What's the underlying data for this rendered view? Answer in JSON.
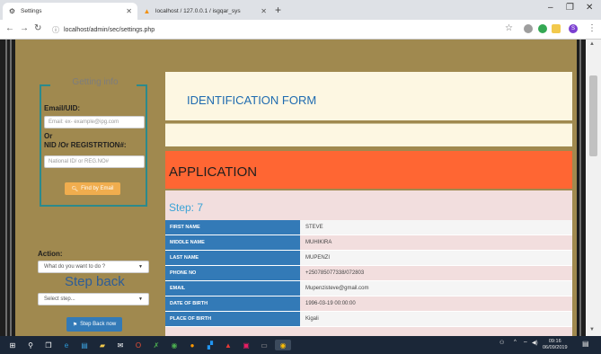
{
  "browser": {
    "tabs": [
      {
        "title": "Settings",
        "active": true
      },
      {
        "title": "localhost / 127.0.0.1 / isgqar_sys",
        "active": false
      }
    ],
    "url": "localhost/admin/sec/settings.php"
  },
  "sidebar": {
    "getting_info_title": "Getting info",
    "email_label": "Email/UID:",
    "email_placeholder": "Email: ex- example@ipg.com",
    "or_label": "Or",
    "nid_label": "NID /Or REGISTRTION#:",
    "nid_placeholder": "National ID/ or REG.NO#",
    "find_button": "Find by Email",
    "action_label": "Action:",
    "action_select_value": "What do you want to do ?",
    "stepback_title": "Step back",
    "step_select_value": "Select step...",
    "stepback_button": "Step Back now"
  },
  "main": {
    "form_title": "IDENTIFICATION FORM",
    "application_title": "APPLICATION",
    "step_label": "Step: 7",
    "rows": [
      {
        "key": "FIRST NAME",
        "value": "STEVE"
      },
      {
        "key": "MIDDLE NAME",
        "value": "MUHIKIRA"
      },
      {
        "key": "LAST NAME",
        "value": "MUPENZI"
      },
      {
        "key": "PHONE NO",
        "value": "+250785077338/072803"
      },
      {
        "key": "EMAIL",
        "value": "Mupenzisteve@gmail.com"
      },
      {
        "key": "DATE OF BIRTH",
        "value": "1996-03-19 00:00:00"
      },
      {
        "key": "PLACE OF BIRTH",
        "value": "Kigali"
      }
    ]
  },
  "taskbar": {
    "time": "09:16",
    "date": "06/09/2019"
  },
  "colors": {
    "page_bg": "#a0894f",
    "accent_orange": "#ff6633",
    "table_key_bg": "#337ab7",
    "sidebar_border": "#2c8a8c"
  }
}
